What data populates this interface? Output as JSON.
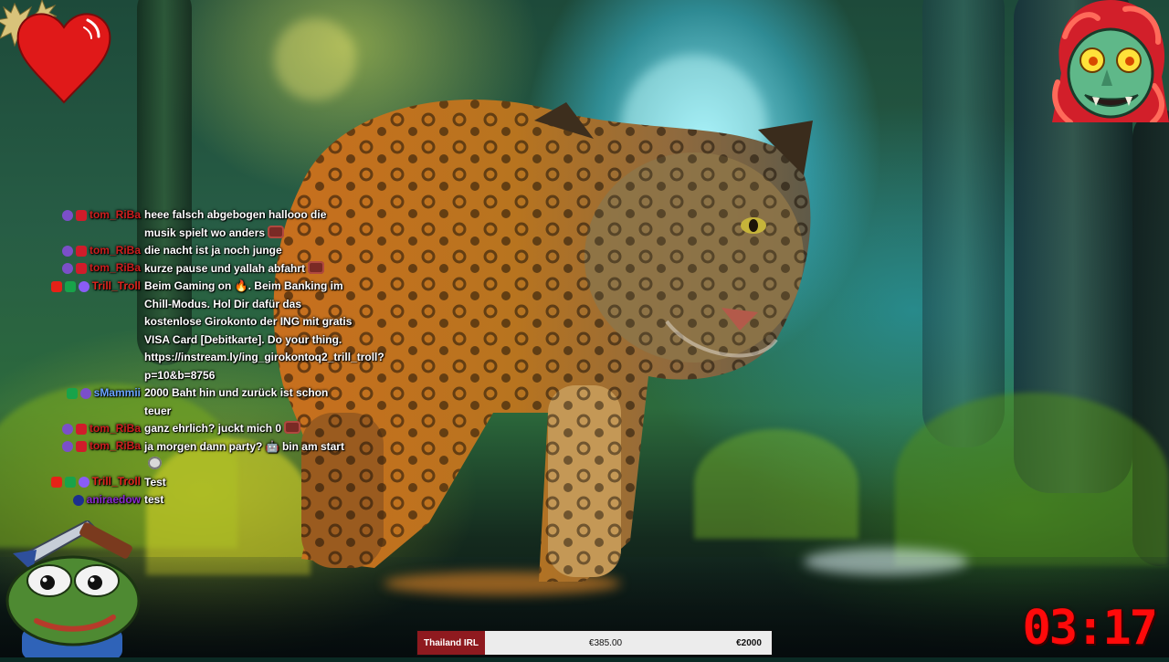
{
  "chat": {
    "messages": [
      {
        "user": "tom_RiBa",
        "user_color": "#cc1f1f",
        "badges": [
          "purple",
          "red"
        ],
        "text": "heee falsch abgebogen hallooo die musik spielt wo anders",
        "emote": "red"
      },
      {
        "user": "tom_RiBa",
        "user_color": "#cc1f1f",
        "badges": [
          "purple",
          "red"
        ],
        "text": "die nacht ist ja noch junge",
        "emote": ""
      },
      {
        "user": "tom_RiBa",
        "user_color": "#cc1f1f",
        "badges": [
          "purple",
          "red"
        ],
        "text": "kurze pause und yallah abfahrt",
        "emote": "red"
      },
      {
        "user": "Trill_Troll",
        "user_color": "#e0261e",
        "badges": [
          "yt",
          "green",
          "violet"
        ],
        "text": "Beim Gaming on 🔥. Beim Banking im Chill-Modus. Hol Dir dafür das kostenlose Girokonto der ING mit gratis VISA Card [Debitkarte]. Do your thing. https://instream.ly/ing_girokontoq2_trill_troll?p=10&b=8756",
        "emote": ""
      },
      {
        "user": "sMammii",
        "user_color": "#6aa4ff",
        "badges": [
          "green",
          "purple"
        ],
        "text": "2000 Baht hin und zurück ist schon teuer",
        "emote": ""
      },
      {
        "user": "tom_RiBa",
        "user_color": "#cc1f1f",
        "badges": [
          "purple",
          "red"
        ],
        "text": "ganz ehrlich? juckt mich 0",
        "emote": "red"
      },
      {
        "user": "tom_RiBa",
        "user_color": "#cc1f1f",
        "badges": [
          "purple",
          "red"
        ],
        "text": "ja morgen dann party? 🤖 bin am start",
        "emote": ""
      },
      {
        "user": "Trill_Troll",
        "user_color": "#e0261e",
        "badges": [
          "yt",
          "green",
          "violet"
        ],
        "text": "Test",
        "emote": ""
      },
      {
        "user": "aniraedow",
        "user_color": "#8a2bd0",
        "badges": [
          "blue"
        ],
        "text": "test",
        "emote": ""
      }
    ]
  },
  "goal": {
    "label": "Thailand IRL",
    "current": "€385.00",
    "target": "€2000",
    "progress": 0.19
  },
  "timer": {
    "value": "03:17"
  },
  "colors": {
    "timer": "#ff0a0a",
    "goal_label_bg": "#8f1a1f",
    "heart": "#e01919"
  },
  "icons": {
    "heart_widget": "heart-icon",
    "troll_cam": "troll-avatar-icon",
    "pepe": "pepe-frog-icon"
  }
}
